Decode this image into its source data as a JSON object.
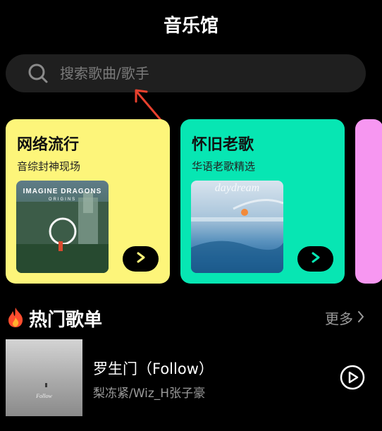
{
  "header": {
    "title": "音乐馆"
  },
  "search": {
    "placeholder": "搜索歌曲/歌手"
  },
  "cards": [
    {
      "title": "网络流行",
      "subtitle": "音综封神现场",
      "cover_text": "IMAGINE DRAGONS",
      "cover_subtext": "ORIGINS",
      "color": "#fdf57a"
    },
    {
      "title": "怀旧老歌",
      "subtitle": "华语老歌精选",
      "cover_text": "daydream",
      "color": "#07e6b3"
    },
    {
      "color": "#f797f1"
    }
  ],
  "section": {
    "title": "热门歌单",
    "more_label": "更多"
  },
  "songs": [
    {
      "title": "罗生门（Follow）",
      "artist": "梨冻紧/Wiz_H张子豪",
      "cover_text": "Follow"
    }
  ],
  "icons": {
    "search": "search-icon",
    "arrow": "arrow-annotation-icon",
    "play": "play-icon",
    "flame": "flame-icon",
    "chevron": "chevron-right-icon",
    "play_circle": "play-circle-icon"
  }
}
